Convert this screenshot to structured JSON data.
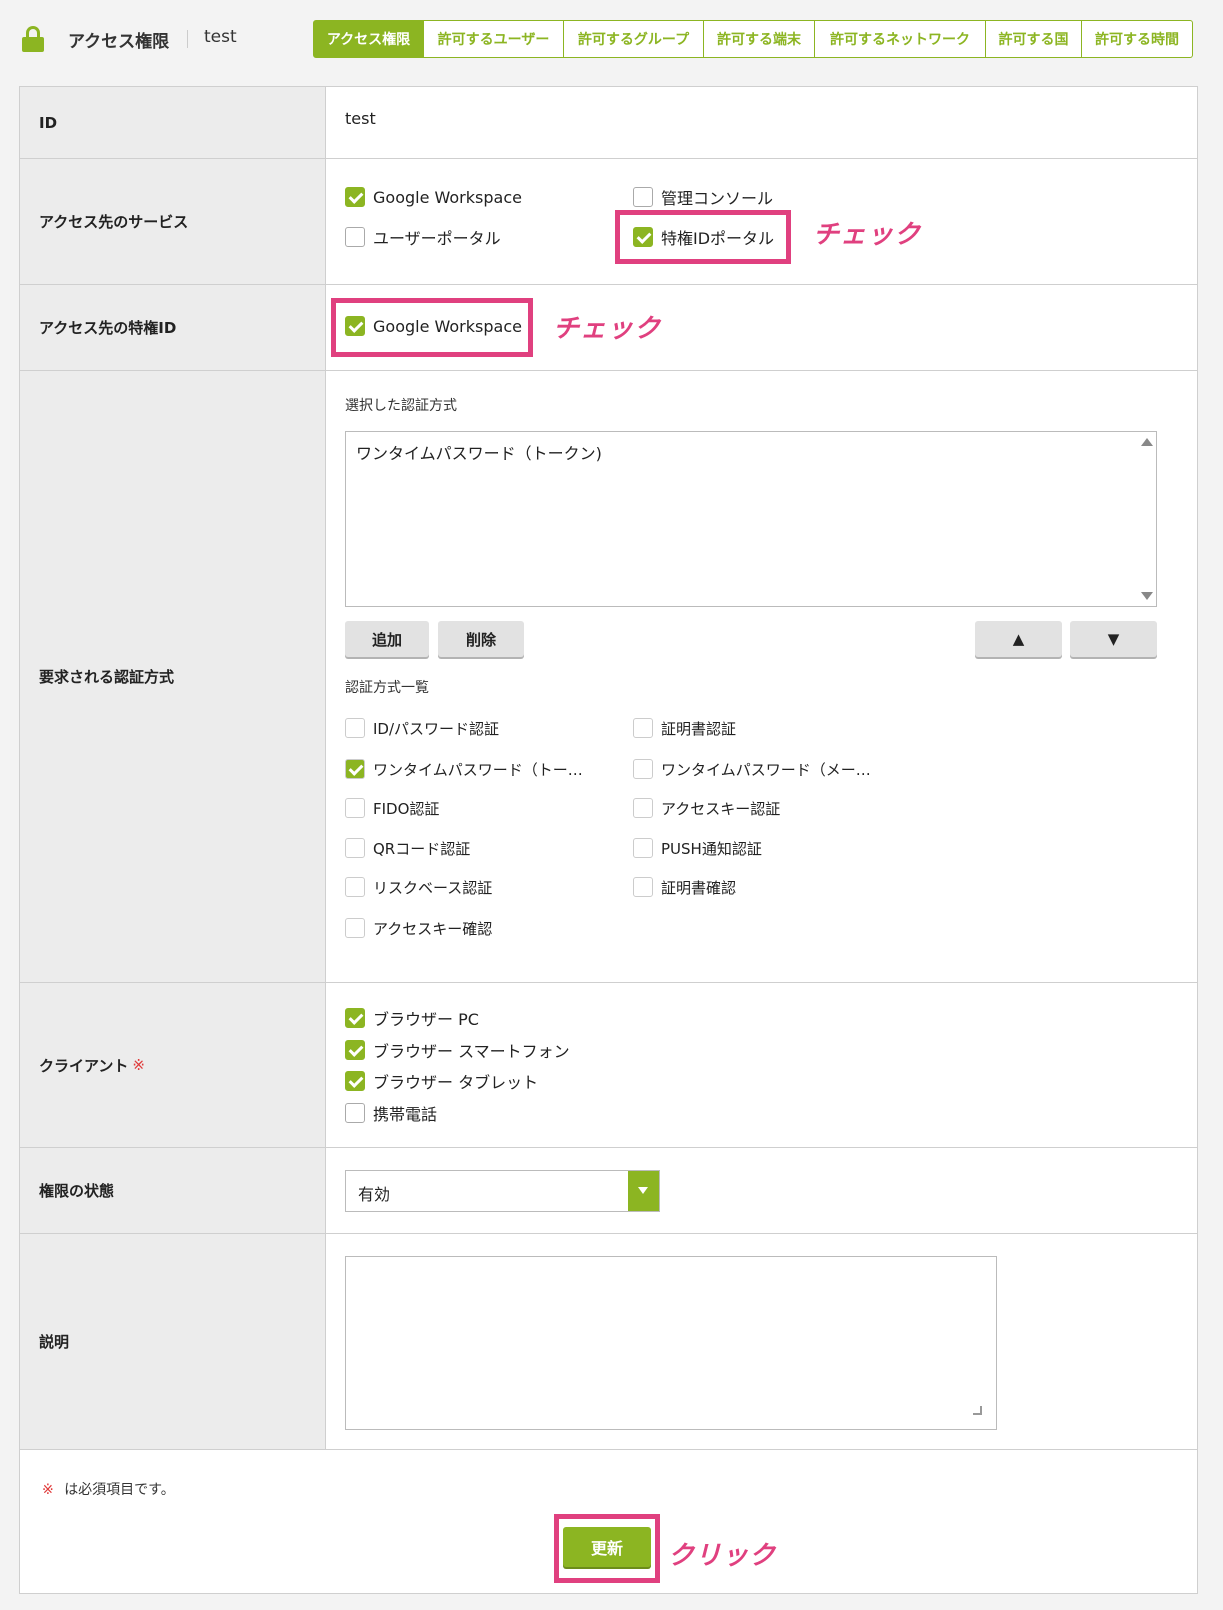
{
  "header": {
    "title": "アクセス権限",
    "id": "test",
    "tabs": [
      {
        "label": "アクセス権限",
        "active": true
      },
      {
        "label": "許可するユーザー",
        "active": false
      },
      {
        "label": "許可するグループ",
        "active": false
      },
      {
        "label": "許可する端末",
        "active": false
      },
      {
        "label": "許可するネットワーク",
        "active": false
      },
      {
        "label": "許可する国",
        "active": false
      },
      {
        "label": "許可する時間",
        "active": false
      }
    ]
  },
  "form": {
    "id_row": {
      "label": "ID",
      "value": "test"
    },
    "services": {
      "label": "アクセス先のサービス",
      "options": [
        {
          "label": "Google Workspace",
          "checked": true
        },
        {
          "label": "管理コンソール",
          "checked": false
        },
        {
          "label": "ユーザーポータル",
          "checked": false
        },
        {
          "label": "特権IDポータル",
          "checked": true
        }
      ]
    },
    "privileged_id": {
      "label": "アクセス先の特権ID",
      "options": [
        {
          "label": "Google Workspace",
          "checked": true
        }
      ]
    },
    "auth": {
      "label": "要求される認証方式",
      "selected_label": "選択した認証方式",
      "selected_items": [
        "ワンタイムパスワード（トークン)"
      ],
      "add": "追加",
      "delete": "削除",
      "up": "▲",
      "down": "▼",
      "list_label": "認証方式一覧",
      "methods": [
        {
          "label": "ID/パスワード認証",
          "checked": false
        },
        {
          "label": "証明書認証",
          "checked": false
        },
        {
          "label": "ワンタイムパスワード（トー…",
          "checked": true
        },
        {
          "label": "ワンタイムパスワード（メー…",
          "checked": false
        },
        {
          "label": "FIDO認証",
          "checked": false
        },
        {
          "label": "アクセスキー認証",
          "checked": false
        },
        {
          "label": "QRコード認証",
          "checked": false
        },
        {
          "label": "PUSH通知認証",
          "checked": false
        },
        {
          "label": "リスクベース認証",
          "checked": false
        },
        {
          "label": "証明書確認",
          "checked": false
        },
        {
          "label": "アクセスキー確認",
          "checked": false
        }
      ]
    },
    "client": {
      "label": "クライアント",
      "required_mark": "※",
      "options": [
        {
          "label": "ブラウザー PC",
          "checked": true
        },
        {
          "label": "ブラウザー スマートフォン",
          "checked": true
        },
        {
          "label": "ブラウザー タブレット",
          "checked": true
        },
        {
          "label": "携帯電話",
          "checked": false
        }
      ]
    },
    "status": {
      "label": "権限の状態",
      "value": "有効"
    },
    "description": {
      "label": "説明",
      "value": ""
    }
  },
  "footer": {
    "required_mark": "※",
    "required_note": "は必須項目です。",
    "update": "更新"
  },
  "annotations": {
    "check1": "チェック",
    "check2": "チェック",
    "click": "クリック"
  },
  "colors": {
    "accent": "#8cb522",
    "annotation": "#e0407f",
    "required": "#e03a3a"
  }
}
